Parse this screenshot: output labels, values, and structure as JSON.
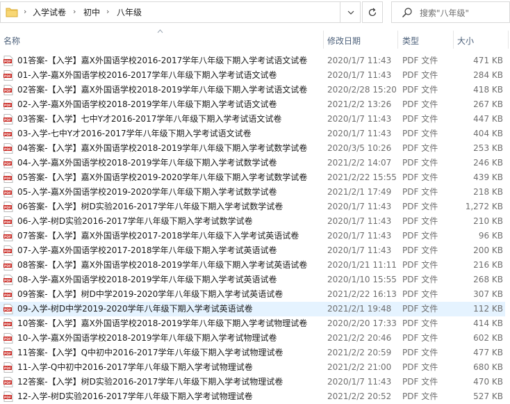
{
  "breadcrumb": {
    "items": [
      "入学试卷",
      "初中",
      "八年级"
    ]
  },
  "search": {
    "placeholder": "搜索\"八年级\""
  },
  "columns": {
    "name": "名称",
    "date": "修改日期",
    "type": "类型",
    "size": "大小"
  },
  "selected_row": 17,
  "files": [
    {
      "name": "01答案-【入学】嘉X外国语学校2016-2017学年八年级下期入学考试语文试卷",
      "date": "2020/1/7 11:43",
      "type": "PDF 文件",
      "size": "471 KB"
    },
    {
      "name": "01-入学-嘉X外国语学校2016-2017学年八年级下期入学考试语文试卷",
      "date": "2020/1/7 11:43",
      "type": "PDF 文件",
      "size": "284 KB"
    },
    {
      "name": "02答案-【入学】嘉X外国语学校2018-2019学年八年级下期入学考试语文试卷",
      "date": "2020/2/28 15:20",
      "type": "PDF 文件",
      "size": "418 KB"
    },
    {
      "name": "02-入学-嘉X外国语学校2018-2019学年八年级下期入学考试语文试卷",
      "date": "2021/2/2 13:26",
      "type": "PDF 文件",
      "size": "267 KB"
    },
    {
      "name": "03答案-【入学】七中Y才2016-2017学年八年级下期入学考试语文试卷",
      "date": "2020/1/7 11:43",
      "type": "PDF 文件",
      "size": "447 KB"
    },
    {
      "name": "03-入学-七中Y才2016-2017学年八年级下期入学考试语文试卷",
      "date": "2020/1/7 11:43",
      "type": "PDF 文件",
      "size": "404 KB"
    },
    {
      "name": "04答案-【入学】嘉X外国语学校2018-2019学年八年级下期入学考试数学试卷",
      "date": "2020/3/5 10:26",
      "type": "PDF 文件",
      "size": "253 KB"
    },
    {
      "name": "04-入学-嘉X外国语学校2018-2019学年八年级下期入学考试数学试卷",
      "date": "2021/2/2 14:07",
      "type": "PDF 文件",
      "size": "246 KB"
    },
    {
      "name": "05答案-【入学】嘉X外国语学校2019-2020学年八年级下期入学考试数学试卷",
      "date": "2021/2/22 15:55",
      "type": "PDF 文件",
      "size": "439 KB"
    },
    {
      "name": "05-入学-嘉X外国语学校2019-2020学年八年级下期入学考试数学试卷",
      "date": "2021/2/1 17:49",
      "type": "PDF 文件",
      "size": "218 KB"
    },
    {
      "name": "06答案-【入学】树D实验2016-2017学年八年级下期入学考试数学试卷",
      "date": "2020/1/7 11:43",
      "type": "PDF 文件",
      "size": "1,272 KB"
    },
    {
      "name": "06-入学-树D实验2016-2017学年八年级下期入学考试数学试卷",
      "date": "2020/1/7 11:43",
      "type": "PDF 文件",
      "size": "210 KB"
    },
    {
      "name": "07答案-【入学】嘉X外国语学校2017-2018学年八年级下入学考试英语试卷",
      "date": "2020/1/7 11:43",
      "type": "PDF 文件",
      "size": "96 KB"
    },
    {
      "name": "07-入学-嘉X外国语学校2017-2018学年八年级下期入学考试英语试卷",
      "date": "2020/1/7 11:43",
      "type": "PDF 文件",
      "size": "200 KB"
    },
    {
      "name": "08答案-【入学】嘉X外国语学校2018-2019学年八年级下期入学考试英语试卷",
      "date": "2020/1/21 11:11",
      "type": "PDF 文件",
      "size": "216 KB"
    },
    {
      "name": "08-入学-嘉X外国语学校2018-2019学年八年级下期入学考试英语试卷",
      "date": "2020/1/10 15:55",
      "type": "PDF 文件",
      "size": "268 KB"
    },
    {
      "name": "09答案-【入学】树D中学2019-2020学年八年级下期入学考试英语试卷",
      "date": "2021/2/22 16:13",
      "type": "PDF 文件",
      "size": "307 KB"
    },
    {
      "name": "09-入学-树D中学2019-2020学年八年级下期入学考试英语试卷",
      "date": "2021/2/1 19:48",
      "type": "PDF 文件",
      "size": "112 KB"
    },
    {
      "name": "10答案-【入学】嘉X外国语学校2018-2019学年八年级下期入学考试物理试卷",
      "date": "2020/2/20 17:33",
      "type": "PDF 文件",
      "size": "414 KB"
    },
    {
      "name": "10-入学-嘉X外国语学校2018-2019学年八年级下期入学考试物理试卷",
      "date": "2021/2/2 20:46",
      "type": "PDF 文件",
      "size": "602 KB"
    },
    {
      "name": "11答案-【入学】Q中初中2016-2017学年八年级下期入学考试物理试卷",
      "date": "2021/2/2 20:59",
      "type": "PDF 文件",
      "size": "477 KB"
    },
    {
      "name": "11-入学-Q中初中2016-2017学年八年级下期入学考试物理试卷",
      "date": "2021/2/2 21:00",
      "type": "PDF 文件",
      "size": "680 KB"
    },
    {
      "name": "12答案-【入学】树D实验2016-2017学年八年级下期入学考试物理试卷",
      "date": "2020/1/7 11:43",
      "type": "PDF 文件",
      "size": "470 KB"
    },
    {
      "name": "12-入学-树D实验2016-2017学年八年级下期入学考试物理试卷",
      "date": "2021/2/2 20:52",
      "type": "PDF 文件",
      "size": "527 KB"
    }
  ]
}
